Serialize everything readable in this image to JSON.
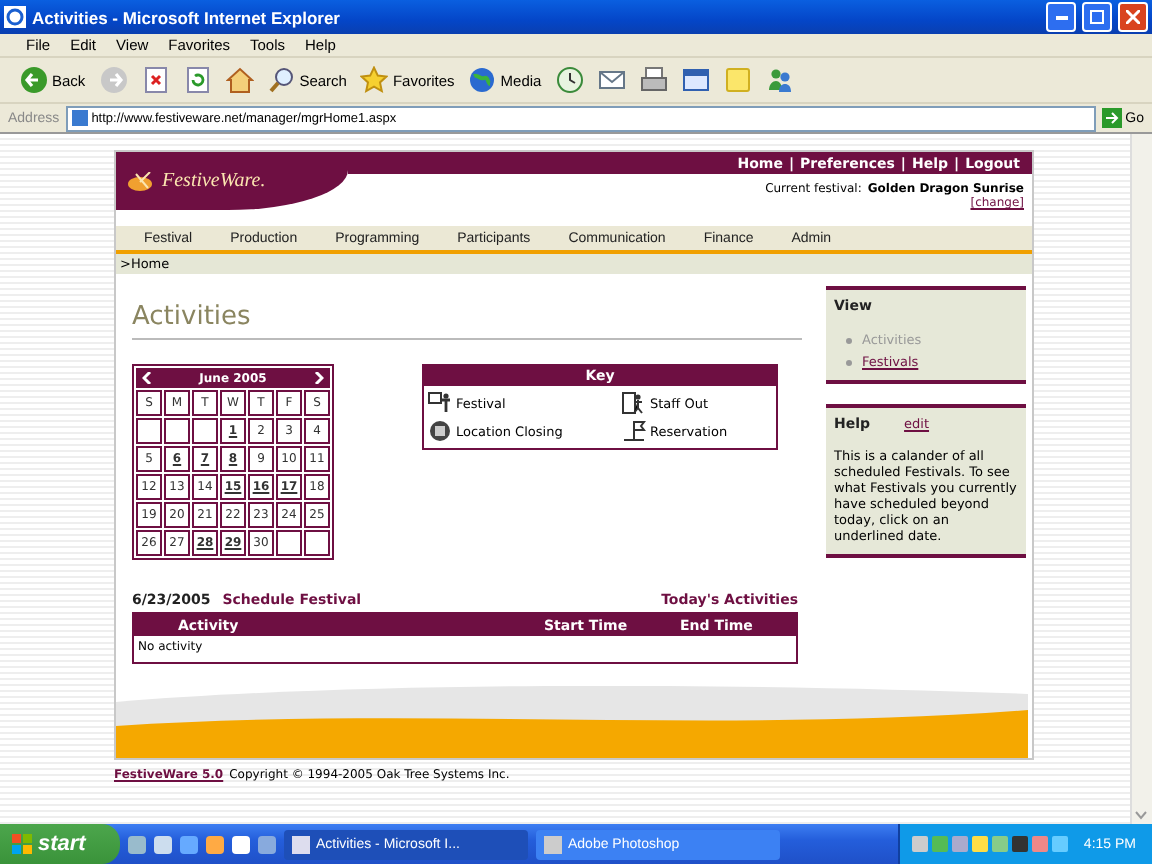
{
  "window": {
    "title": "Activities - Microsoft Internet Explorer"
  },
  "menu": [
    "File",
    "Edit",
    "View",
    "Favorites",
    "Tools",
    "Help"
  ],
  "toolbar": [
    {
      "kind": "back",
      "label": "Back"
    },
    {
      "kind": "forward"
    },
    {
      "kind": "stop"
    },
    {
      "kind": "refresh"
    },
    {
      "kind": "home"
    },
    {
      "kind": "search",
      "label": "Search"
    },
    {
      "kind": "favorites",
      "label": "Favorites"
    },
    {
      "kind": "media",
      "label": "Media"
    },
    {
      "kind": "history"
    },
    {
      "kind": "mail"
    },
    {
      "kind": "print"
    },
    {
      "kind": "edit"
    },
    {
      "kind": "note"
    },
    {
      "kind": "messenger"
    }
  ],
  "address": {
    "label": "Address",
    "url": "http://www.festiveware.net/manager/mgrHome1.aspx",
    "go": "Go"
  },
  "site": {
    "logo": "FestiveWare.",
    "top_links": [
      "Home",
      "Preferences",
      "Help",
      "Logout"
    ],
    "separator": "|",
    "current_festival": {
      "label": "Current festival:",
      "name": "Golden Dragon Sunrise",
      "change": "[change]"
    },
    "nav": [
      "Festival",
      "Production",
      "Programming",
      "Participants",
      "Communication",
      "Finance",
      "Admin"
    ],
    "breadcrumb": ">Home",
    "page_title": "Activities",
    "calendar": {
      "month": "June 2005",
      "weekdays": [
        "S",
        "M",
        "T",
        "W",
        "T",
        "F",
        "S"
      ],
      "cells": [
        {
          "kind": "blank"
        },
        {
          "kind": "blank"
        },
        {
          "kind": "blank"
        },
        {
          "kind": "day",
          "day": "1",
          "linked": true
        },
        {
          "kind": "day",
          "day": "2",
          "linked": false
        },
        {
          "kind": "day",
          "day": "3",
          "linked": false
        },
        {
          "kind": "day",
          "day": "4",
          "linked": false
        },
        {
          "kind": "day",
          "day": "5",
          "linked": false
        },
        {
          "kind": "day",
          "day": "6",
          "linked": true
        },
        {
          "kind": "day",
          "day": "7",
          "linked": true
        },
        {
          "kind": "day",
          "day": "8",
          "linked": true
        },
        {
          "kind": "day",
          "day": "9",
          "linked": false
        },
        {
          "kind": "day",
          "day": "10",
          "linked": false
        },
        {
          "kind": "day",
          "day": "11",
          "linked": false
        },
        {
          "kind": "day",
          "day": "12",
          "linked": false
        },
        {
          "kind": "day",
          "day": "13",
          "linked": false
        },
        {
          "kind": "day",
          "day": "14",
          "linked": false
        },
        {
          "kind": "day",
          "day": "15",
          "linked": true
        },
        {
          "kind": "day",
          "day": "16",
          "linked": true
        },
        {
          "kind": "day",
          "day": "17",
          "linked": true
        },
        {
          "kind": "day",
          "day": "18",
          "linked": false
        },
        {
          "kind": "day",
          "day": "19",
          "linked": false
        },
        {
          "kind": "day",
          "day": "20",
          "linked": false
        },
        {
          "kind": "day",
          "day": "21",
          "linked": false
        },
        {
          "kind": "day",
          "day": "22",
          "linked": false
        },
        {
          "kind": "day",
          "day": "23",
          "linked": false
        },
        {
          "kind": "day",
          "day": "24",
          "linked": false
        },
        {
          "kind": "day",
          "day": "25",
          "linked": false
        },
        {
          "kind": "day",
          "day": "26",
          "linked": false
        },
        {
          "kind": "day",
          "day": "27",
          "linked": false
        },
        {
          "kind": "day",
          "day": "28",
          "linked": true
        },
        {
          "kind": "day",
          "day": "29",
          "linked": true
        },
        {
          "kind": "day",
          "day": "30",
          "linked": false
        },
        {
          "kind": "blank"
        },
        {
          "kind": "blank"
        }
      ]
    },
    "key": {
      "title": "Key",
      "items": [
        {
          "kind": "festival",
          "label": "Festival"
        },
        {
          "kind": "staff_out",
          "label": "Staff Out"
        },
        {
          "kind": "location_closing",
          "label": "Location Closing"
        },
        {
          "kind": "reservation",
          "label": "Reservation"
        }
      ]
    },
    "schedule": {
      "date": "6/23/2005",
      "action": "Schedule Festival",
      "today": "Today's Activities",
      "columns": [
        "Activity",
        "Start Time",
        "End Time"
      ],
      "empty": "No activity"
    },
    "sidebar": {
      "view": {
        "title": "View",
        "items": [
          {
            "label": "Activities",
            "current": true
          },
          {
            "label": "Festivals",
            "current": false
          }
        ]
      },
      "help": {
        "title": "Help",
        "edit": "edit",
        "text": "This is a calander of all scheduled Festivals. To see what Festivals you currently have scheduled beyond today, click on an underlined date."
      }
    },
    "footer": {
      "product": "FestiveWare 5.0",
      "copyright": "Copyright © 1994-2005 Oak Tree Systems Inc."
    }
  },
  "taskbar": {
    "start": "start",
    "tasks": [
      {
        "label": "Activities - Microsoft I...",
        "selected": true
      },
      {
        "label": "Adobe Photoshop",
        "selected": false
      }
    ],
    "clock": "4:15 PM"
  }
}
